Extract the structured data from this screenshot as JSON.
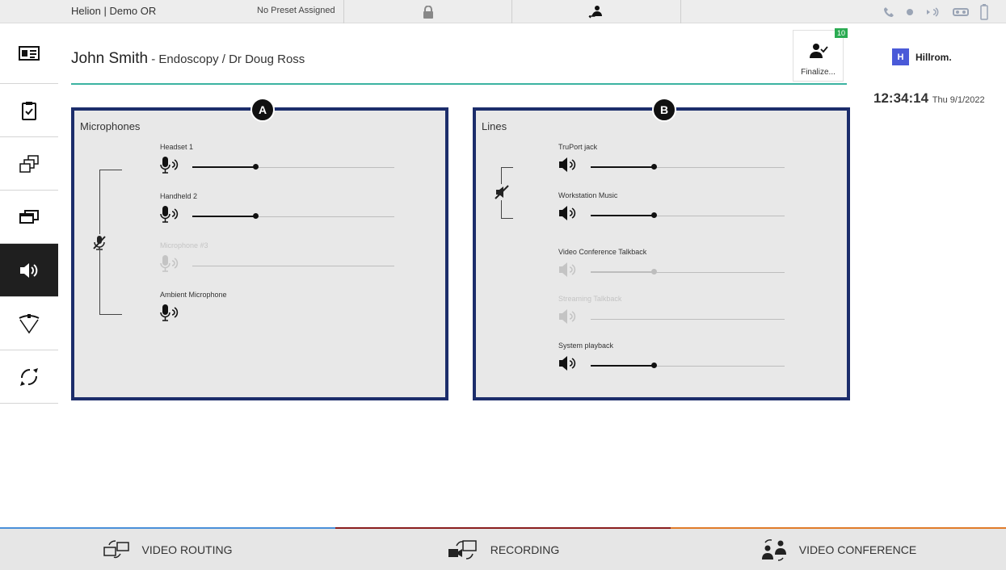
{
  "topbar": {
    "room": "Helion | Demo OR",
    "preset": "No Preset Assigned",
    "status_icons": [
      "phone-icon",
      "record-dot-icon",
      "broadcast-icon",
      "mask-icon",
      "battery-icon"
    ]
  },
  "sidebar": {
    "items": [
      {
        "name": "patient-info",
        "icon": "id-card-icon"
      },
      {
        "name": "checklist",
        "icon": "clipboard-check-icon"
      },
      {
        "name": "layouts",
        "icon": "windows-numbered-icon"
      },
      {
        "name": "displays",
        "icon": "monitors-icon"
      },
      {
        "name": "audio",
        "icon": "speaker-icon",
        "active": true
      },
      {
        "name": "lights",
        "icon": "surgical-light-icon"
      },
      {
        "name": "cameras",
        "icon": "ptz-icon"
      }
    ]
  },
  "header": {
    "patient": "John Smith",
    "procedure": " - Endoscopy / Dr Doug Ross",
    "finalize_label": "Finalize...",
    "finalize_badge": "10"
  },
  "brand": {
    "logo_text": "Hillrom.",
    "logo_mark": "H"
  },
  "clock": {
    "time": "12:34:14",
    "date": "Thu 9/1/2022"
  },
  "panels": {
    "microphones": {
      "title": "Microphones",
      "callout": "A",
      "channels": [
        {
          "name": "Headset 1",
          "level": 0.35,
          "enabled": true
        },
        {
          "name": "Handheld 2",
          "level": 0.35,
          "enabled": true
        },
        {
          "name": "Microphone #3",
          "level": 0.0,
          "enabled": false
        },
        {
          "name": "Ambient Microphone",
          "level": null,
          "enabled": true
        }
      ]
    },
    "lines": {
      "title": "Lines",
      "callout": "B",
      "channels": [
        {
          "name": "TruPort jack",
          "level": 0.32,
          "enabled": true
        },
        {
          "name": "Workstation Music",
          "level": 0.32,
          "enabled": true
        },
        {
          "name": "Video Conference Talkback",
          "level": 0.32,
          "enabled": false
        },
        {
          "name": "Streaming Talkback",
          "level": 0.0,
          "enabled": false
        },
        {
          "name": "System playback",
          "level": 0.32,
          "enabled": true
        }
      ]
    }
  },
  "bottombar": {
    "video_routing": "VIDEO ROUTING",
    "recording": "RECORDING",
    "video_conference": "VIDEO CONFERENCE"
  },
  "colors": {
    "panel_border": "#1c2d6b",
    "title_underline": "#3bb3a1",
    "badge": "#2bab52",
    "video_routing_accent": "#4a90d9",
    "recording_accent": "#8b1e1e",
    "video_conference_accent": "#e07b2a",
    "brand_mark": "#4a5ad8"
  }
}
